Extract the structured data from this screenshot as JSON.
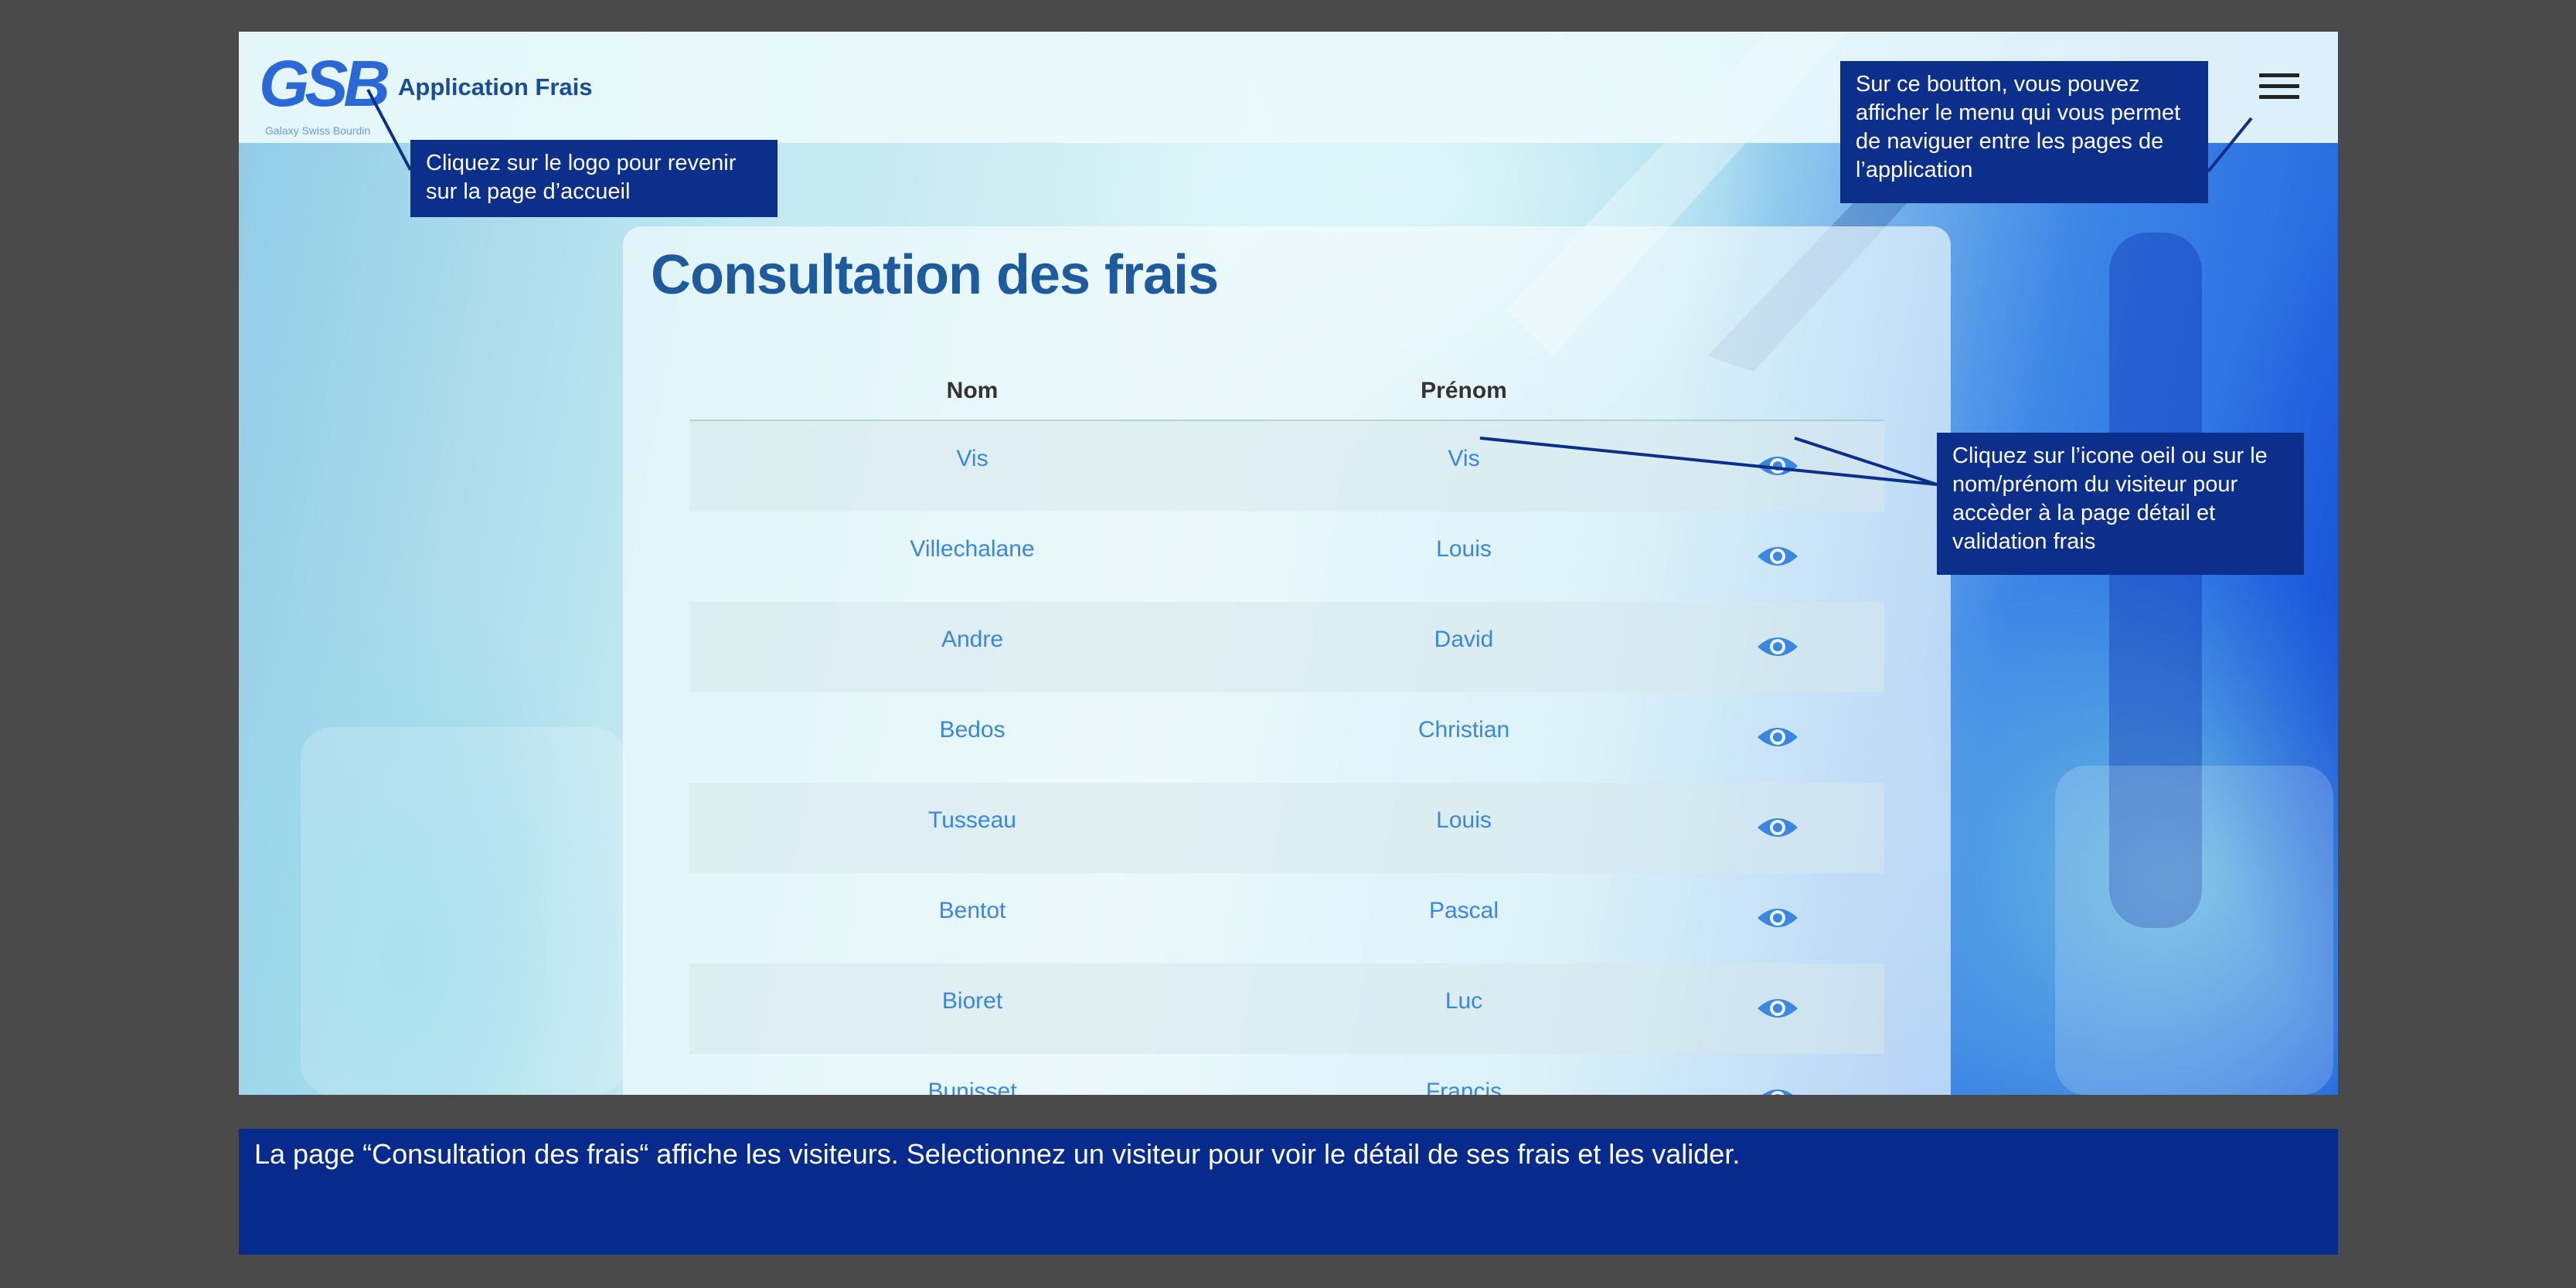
{
  "header": {
    "logo_text": "GSB",
    "logo_tagline": "Galaxy Swiss Bourdin",
    "app_name": "Application Frais",
    "menu_icon": "hamburger-menu-icon"
  },
  "main": {
    "title": "Consultation des frais",
    "columns": [
      "Nom",
      "Prénom"
    ],
    "rows": [
      {
        "nom": "Vis",
        "prenom": "Vis"
      },
      {
        "nom": "Villechalane",
        "prenom": "Louis"
      },
      {
        "nom": "Andre",
        "prenom": "David"
      },
      {
        "nom": "Bedos",
        "prenom": "Christian"
      },
      {
        "nom": "Tusseau",
        "prenom": "Louis"
      },
      {
        "nom": "Bentot",
        "prenom": "Pascal"
      },
      {
        "nom": "Bioret",
        "prenom": "Luc"
      },
      {
        "nom": "Bunisset",
        "prenom": "Francis"
      }
    ],
    "row_action_icon": "eye-icon"
  },
  "annotations": {
    "logo": "Cliquez sur le logo pour revenir sur la page d’accueil",
    "menu": "Sur ce boutton, vous pouvez afficher le menu qui vous permet de naviguer entre les pages de l’application",
    "eye": "Cliquez sur l’icone oeil ou sur le nom/prénom du visiteur pour accèder à la page détail et validation frais"
  },
  "caption": "La page “Consultation des frais“ affiche les visiteurs. Selectionnez un visiteur pour voir le détail de ses frais et les valider.",
  "colors": {
    "callout_bg": "#0b2f8a",
    "title": "#1e5a9e",
    "cell_text": "#3a86e0",
    "eye": "#3a86e0"
  }
}
